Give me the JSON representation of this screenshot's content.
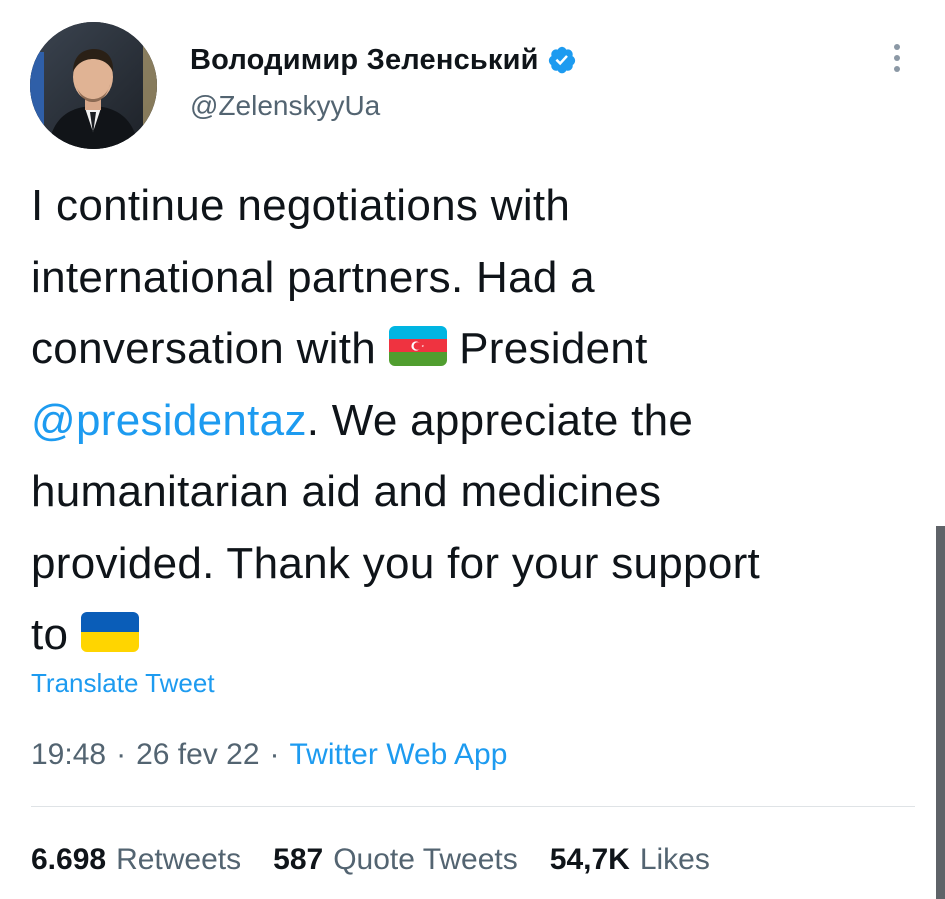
{
  "author": {
    "display_name": "Володимир Зеленський",
    "handle": "@ZelenskyyUa",
    "verified": true,
    "verified_color": "#1d9bf0"
  },
  "tweet": {
    "line1": "I continue negotiations with",
    "line2": "international partners. Had a",
    "line3_a": "conversation with",
    "line3_flag": "azerbaijan-flag",
    "line3_b": "President",
    "mention": "@presidentaz",
    "line4_rest": ". We appreciate the",
    "line5": "humanitarian aid and medicines",
    "line6": "provided. Thank you for your support",
    "line7": "to",
    "line7_flag": "ukraine-flag"
  },
  "translate_label": "Translate Tweet",
  "meta": {
    "time": "19:48",
    "separator": "·",
    "date": "26 fev 22",
    "source": "Twitter Web App"
  },
  "stats": [
    {
      "value": "6.698",
      "label": "Retweets"
    },
    {
      "value": "587",
      "label": "Quote Tweets"
    },
    {
      "value": "54,7K",
      "label": "Likes"
    }
  ],
  "colors": {
    "link": "#1d9bf0",
    "text": "#0f1419",
    "secondary": "#536471"
  }
}
